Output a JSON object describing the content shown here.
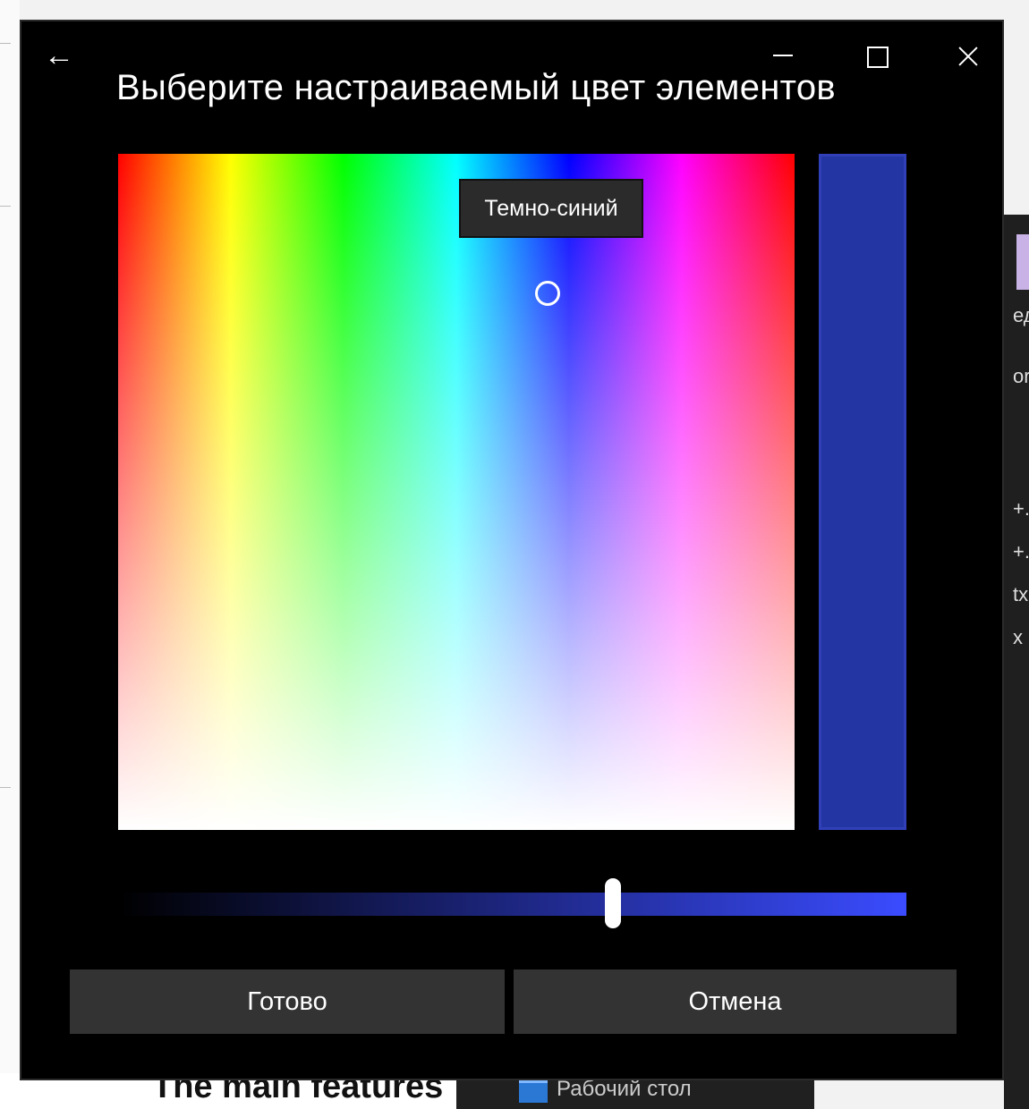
{
  "dialog": {
    "title": "Выберите настраиваемый цвет элементов",
    "tooltip": "Темно-синий",
    "preview_color": "#2335a3",
    "brightness_gradient": [
      "#000000",
      "#3a4cff"
    ],
    "brightness_value": 0.63,
    "buttons": {
      "done": "Готово",
      "cancel": "Отмена"
    }
  },
  "background": {
    "right_fragments": [
      "ед",
      "or",
      "+.",
      "+.",
      "tx",
      "x"
    ],
    "bottom_left_text": "The main features",
    "taskbar_item": "Рабочий стол"
  }
}
